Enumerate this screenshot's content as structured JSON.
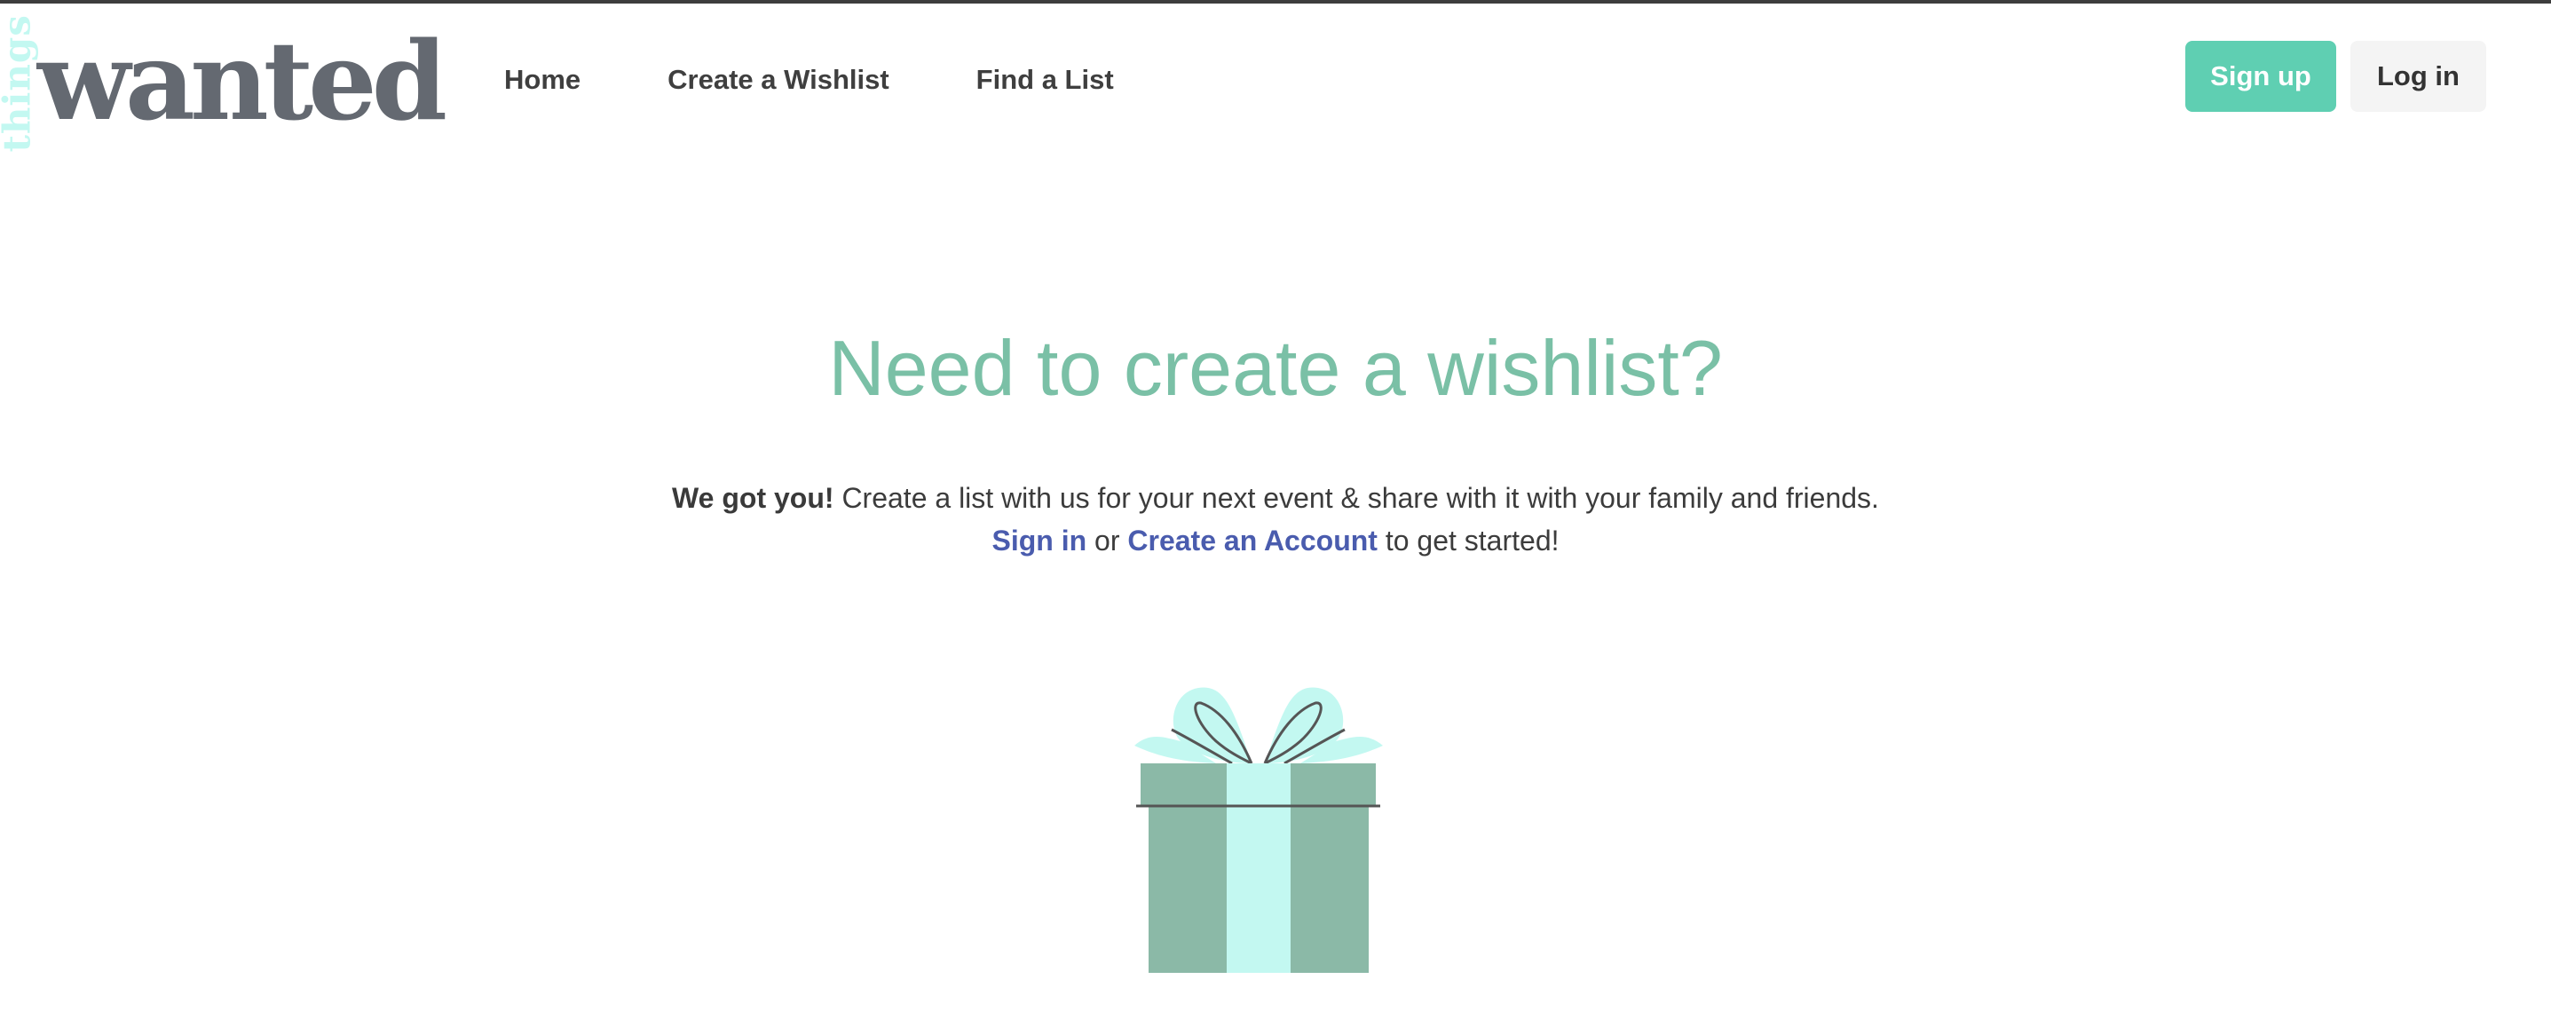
{
  "logo": {
    "small_word": "things",
    "main_word": "wanted"
  },
  "nav": {
    "items": [
      {
        "label": "Home"
      },
      {
        "label": "Create a Wishlist"
      },
      {
        "label": "Find a List"
      }
    ]
  },
  "auth": {
    "signup_label": "Sign up",
    "login_label": "Log in"
  },
  "hero": {
    "title": "Need to create a wishlist?",
    "bold_intro": "We got you!",
    "description": " Create a list with us for your next event & share with it with your family and friends.",
    "signin_link": "Sign in",
    "or_text": " or ",
    "create_account_link": "Create an Account",
    "cta_suffix": " to get started!"
  },
  "illustration": {
    "icon": "gift-icon"
  },
  "colors": {
    "accent": "#5fcfb2",
    "headline": "#7ac0a6",
    "link": "#4a5cae",
    "logo_text": "#646971",
    "logo_accent": "#c3f8f1",
    "gift_box": "#8bb9a7",
    "gift_ribbon": "#c3f8f1"
  }
}
